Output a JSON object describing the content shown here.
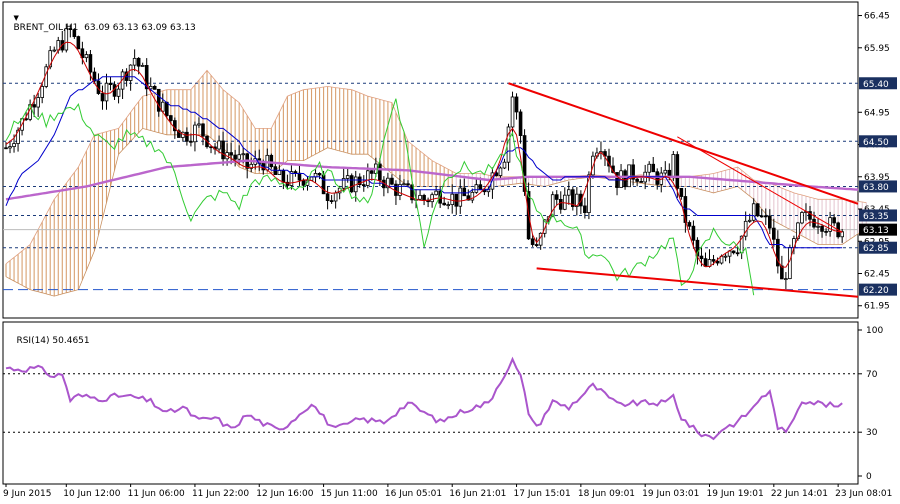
{
  "chart_data": {
    "type": "candlestick",
    "symbol_header": "BRENT_OIL,H1  63.09 63.13 63.09 63.13",
    "colors": {
      "bull": "#000000",
      "bear": "#000000",
      "tenkan": "#cc0000",
      "kijun": "#0000cc",
      "chikou": "#33cc33",
      "ma": "#bb66cc",
      "cloud_up": "#d8a070",
      "cloud_down": "#e6c8d2",
      "trendline": "#ee0000",
      "support_line": "#2255cc",
      "hline": "#1a3a7a",
      "rsi_line": "#aa55cc"
    },
    "price_axis": {
      "ylim": [
        61.76,
        66.66
      ],
      "ticks": [
        "66.45",
        "65.95",
        "64.95",
        "64.45",
        "63.95",
        "63.45",
        "62.95",
        "62.45",
        "61.95"
      ],
      "tick_values": [
        66.45,
        65.95,
        64.95,
        64.45,
        63.95,
        63.45,
        62.95,
        62.45,
        61.95
      ]
    },
    "x_axis": {
      "labels": [
        "9 Jun 2015",
        "10 Jun 12:00",
        "11 Jun 06:00",
        "11 Jun 22:00",
        "12 Jun 16:00",
        "15 Jun 11:00",
        "16 Jun 05:01",
        "16 Jun 21:01",
        "17 Jun 15:01",
        "18 Jun 09:01",
        "19 Jun 03:01",
        "19 Jun 19:01",
        "22 Jun 14:01",
        "23 Jun 08:01"
      ],
      "label_index": [
        0,
        15,
        31,
        47,
        63,
        79,
        95,
        111,
        127,
        143,
        159,
        175,
        191,
        207
      ]
    },
    "levels": [
      {
        "value": 65.4,
        "label": "65.40",
        "style": "dash"
      },
      {
        "value": 64.5,
        "label": "64.50",
        "style": "dash"
      },
      {
        "value": 63.8,
        "label": "63.80",
        "style": "dash"
      },
      {
        "value": 63.35,
        "label": "63.35",
        "style": "dash"
      },
      {
        "value": 62.85,
        "label": "62.85",
        "style": "dash"
      },
      {
        "value": 62.2,
        "label": "62.20",
        "style": "longdash"
      }
    ],
    "current_price": {
      "value": 63.13,
      "label": "63.13"
    },
    "trendlines": [
      {
        "points": [
          [
            125,
            65.4
          ],
          [
            214,
            63.53
          ]
        ],
        "width": 2
      },
      {
        "points": [
          [
            132,
            62.53
          ],
          [
            214,
            62.09
          ]
        ],
        "width": 2
      },
      {
        "points": [
          [
            167,
            64.57
          ],
          [
            208,
            63.09
          ]
        ],
        "width": 1
      }
    ],
    "ohlc_key": [
      [
        0,
        64.4
      ],
      [
        4,
        64.8
      ],
      [
        8,
        65.3
      ],
      [
        12,
        65.9
      ],
      [
        16,
        66.2
      ],
      [
        20,
        65.7
      ],
      [
        24,
        65.2
      ],
      [
        28,
        65.4
      ],
      [
        32,
        65.8
      ],
      [
        36,
        65.3
      ],
      [
        40,
        64.9
      ],
      [
        44,
        64.6
      ],
      [
        48,
        64.7
      ],
      [
        52,
        64.4
      ],
      [
        56,
        64.3
      ],
      [
        60,
        64.1
      ],
      [
        64,
        64.2
      ],
      [
        68,
        63.9
      ],
      [
        72,
        63.9
      ],
      [
        76,
        64.0
      ],
      [
        80,
        63.7
      ],
      [
        84,
        63.8
      ],
      [
        88,
        63.9
      ],
      [
        92,
        64.0
      ],
      [
        96,
        63.8
      ],
      [
        100,
        63.7
      ],
      [
        104,
        63.6
      ],
      [
        108,
        63.7
      ],
      [
        112,
        63.6
      ],
      [
        118,
        63.7
      ],
      [
        124,
        64.3
      ],
      [
        126,
        65.2
      ],
      [
        128,
        64.6
      ],
      [
        130,
        63.0
      ],
      [
        132,
        62.8
      ],
      [
        136,
        63.6
      ],
      [
        140,
        63.6
      ],
      [
        144,
        63.5
      ],
      [
        146,
        64.4
      ],
      [
        148,
        64.5
      ],
      [
        152,
        63.9
      ],
      [
        156,
        64.0
      ],
      [
        160,
        64.0
      ],
      [
        164,
        63.9
      ],
      [
        166,
        64.2
      ],
      [
        168,
        63.5
      ],
      [
        172,
        62.7
      ],
      [
        174,
        62.5
      ],
      [
        178,
        62.8
      ],
      [
        182,
        62.9
      ],
      [
        186,
        63.4
      ],
      [
        190,
        63.2
      ],
      [
        193,
        62.3
      ],
      [
        196,
        62.9
      ],
      [
        198,
        63.3
      ],
      [
        202,
        63.3
      ],
      [
        206,
        63.15
      ],
      [
        208,
        63.13
      ]
    ],
    "kijun_key": [
      [
        0,
        63.5
      ],
      [
        4,
        64.0
      ],
      [
        8,
        64.2
      ],
      [
        12,
        64.6
      ],
      [
        16,
        65.2
      ],
      [
        24,
        65.5
      ],
      [
        32,
        65.5
      ],
      [
        40,
        65.1
      ],
      [
        48,
        64.9
      ],
      [
        56,
        64.6
      ],
      [
        64,
        64.1
      ],
      [
        72,
        64.0
      ],
      [
        80,
        63.9
      ],
      [
        88,
        63.9
      ],
      [
        96,
        63.8
      ],
      [
        104,
        63.75
      ],
      [
        112,
        63.7
      ],
      [
        120,
        63.75
      ],
      [
        124,
        64.3
      ],
      [
        128,
        64.4
      ],
      [
        132,
        64.1
      ],
      [
        136,
        63.9
      ],
      [
        142,
        63.95
      ],
      [
        146,
        63.95
      ],
      [
        152,
        63.9
      ],
      [
        158,
        63.95
      ],
      [
        164,
        63.95
      ],
      [
        168,
        63.5
      ],
      [
        172,
        63.35
      ],
      [
        180,
        63.35
      ],
      [
        186,
        63.35
      ],
      [
        190,
        62.9
      ],
      [
        196,
        62.85
      ],
      [
        208,
        62.85
      ]
    ],
    "ma_key": [
      [
        0,
        63.6
      ],
      [
        20,
        63.8
      ],
      [
        40,
        64.1
      ],
      [
        60,
        64.2
      ],
      [
        80,
        64.1
      ],
      [
        100,
        64.05
      ],
      [
        120,
        63.9
      ],
      [
        130,
        63.95
      ],
      [
        150,
        63.95
      ],
      [
        170,
        63.95
      ],
      [
        180,
        63.9
      ],
      [
        190,
        63.85
      ],
      [
        200,
        63.8
      ],
      [
        212,
        63.75
      ]
    ],
    "chikou_key": [
      [
        0,
        64.6
      ],
      [
        6,
        65.0
      ],
      [
        10,
        64.8
      ],
      [
        14,
        65.0
      ],
      [
        18,
        65.0
      ],
      [
        22,
        64.6
      ],
      [
        26,
        64.4
      ],
      [
        30,
        64.6
      ],
      [
        34,
        64.5
      ],
      [
        38,
        64.4
      ],
      [
        42,
        64.0
      ],
      [
        46,
        63.3
      ],
      [
        50,
        63.6
      ],
      [
        54,
        63.7
      ],
      [
        58,
        63.5
      ],
      [
        62,
        63.9
      ],
      [
        66,
        63.9
      ],
      [
        70,
        63.8
      ],
      [
        74,
        63.8
      ],
      [
        78,
        64.1
      ],
      [
        82,
        63.9
      ],
      [
        86,
        63.7
      ],
      [
        90,
        63.5
      ],
      [
        94,
        64.5
      ],
      [
        97,
        65.2
      ],
      [
        100,
        64.3
      ],
      [
        104,
        62.85
      ],
      [
        106,
        63.4
      ],
      [
        110,
        64.0
      ],
      [
        114,
        64.1
      ],
      [
        118,
        64.0
      ],
      [
        122,
        64.1
      ],
      [
        126,
        64.6
      ],
      [
        130,
        63.6
      ],
      [
        134,
        63.3
      ],
      [
        138,
        63.3
      ],
      [
        142,
        63.1
      ],
      [
        145,
        62.7
      ],
      [
        148,
        62.8
      ],
      [
        152,
        62.4
      ],
      [
        156,
        62.5
      ],
      [
        162,
        62.8
      ],
      [
        166,
        63.0
      ],
      [
        168,
        62.2
      ],
      [
        172,
        62.7
      ],
      [
        176,
        63.1
      ],
      [
        180,
        62.9
      ],
      [
        184,
        62.8
      ],
      [
        186,
        62.2
      ]
    ],
    "cloud_key": [
      [
        0,
        62.4,
        62.6
      ],
      [
        6,
        62.2,
        62.9
      ],
      [
        12,
        62.1,
        63.6
      ],
      [
        18,
        62.2,
        64.1
      ],
      [
        22,
        62.8,
        64.6
      ],
      [
        28,
        64.3,
        64.7
      ],
      [
        34,
        64.7,
        65.2
      ],
      [
        40,
        64.6,
        65.3
      ],
      [
        46,
        64.6,
        65.3
      ],
      [
        50,
        64.6,
        65.6
      ],
      [
        54,
        64.4,
        65.3
      ],
      [
        58,
        64.1,
        65.1
      ],
      [
        62,
        64.0,
        64.7
      ],
      [
        66,
        64.0,
        64.7
      ],
      [
        70,
        64.2,
        65.2
      ],
      [
        74,
        64.2,
        65.3
      ],
      [
        80,
        64.4,
        65.35
      ],
      [
        86,
        64.3,
        65.3
      ],
      [
        90,
        64.3,
        65.2
      ],
      [
        96,
        64.0,
        65.1
      ],
      [
        100,
        63.8,
        64.5
      ],
      [
        106,
        63.8,
        64.2
      ],
      [
        112,
        63.8,
        64.0
      ],
      [
        118,
        63.8,
        64.0
      ],
      [
        122,
        63.8,
        63.95
      ],
      [
        128,
        63.85,
        63.95
      ],
      [
        134,
        63.8,
        63.95
      ],
      [
        140,
        63.9,
        63.95
      ],
      [
        146,
        63.95,
        63.98
      ],
      [
        152,
        63.9,
        63.95
      ],
      [
        158,
        63.85,
        63.98
      ],
      [
        164,
        63.8,
        63.9
      ],
      [
        170,
        63.8,
        63.95
      ],
      [
        176,
        63.7,
        64.0
      ],
      [
        182,
        63.8,
        64.1
      ],
      [
        186,
        63.6,
        63.9
      ],
      [
        190,
        63.3,
        63.85
      ],
      [
        196,
        63.1,
        63.7
      ],
      [
        202,
        62.9,
        63.6
      ],
      [
        208,
        62.9,
        63.6
      ],
      [
        214,
        63.15,
        63.55
      ]
    ],
    "rsi": {
      "header": "RSI(14) 50.4651",
      "ylim": [
        0,
        100
      ],
      "ticks": [
        "100",
        "70",
        "30",
        "0"
      ],
      "tick_values": [
        100,
        70,
        30,
        0
      ],
      "levels": [
        70,
        30
      ],
      "key": [
        [
          0,
          74
        ],
        [
          4,
          73
        ],
        [
          8,
          74
        ],
        [
          12,
          68
        ],
        [
          14,
          70
        ],
        [
          16,
          52
        ],
        [
          18,
          55
        ],
        [
          24,
          53
        ],
        [
          28,
          55
        ],
        [
          32,
          54
        ],
        [
          36,
          51
        ],
        [
          40,
          43
        ],
        [
          44,
          47
        ],
        [
          48,
          38
        ],
        [
          52,
          40
        ],
        [
          56,
          32
        ],
        [
          60,
          42
        ],
        [
          64,
          36
        ],
        [
          68,
          31
        ],
        [
          72,
          40
        ],
        [
          76,
          50
        ],
        [
          80,
          37
        ],
        [
          82,
          32
        ],
        [
          88,
          39
        ],
        [
          94,
          37
        ],
        [
          100,
          50
        ],
        [
          108,
          37
        ],
        [
          114,
          45
        ],
        [
          120,
          50
        ],
        [
          124,
          70
        ],
        [
          126,
          79
        ],
        [
          128,
          68
        ],
        [
          130,
          44
        ],
        [
          132,
          33
        ],
        [
          136,
          51
        ],
        [
          140,
          47
        ],
        [
          146,
          62
        ],
        [
          148,
          58
        ],
        [
          152,
          49
        ],
        [
          158,
          50
        ],
        [
          164,
          50
        ],
        [
          166,
          55
        ],
        [
          168,
          40
        ],
        [
          172,
          30
        ],
        [
          176,
          26
        ],
        [
          178,
          32
        ],
        [
          182,
          37
        ],
        [
          186,
          47
        ],
        [
          188,
          55
        ],
        [
          190,
          57
        ],
        [
          192,
          34
        ],
        [
          194,
          29
        ],
        [
          198,
          52
        ],
        [
          202,
          50
        ],
        [
          206,
          48
        ],
        [
          208,
          48
        ]
      ]
    }
  }
}
